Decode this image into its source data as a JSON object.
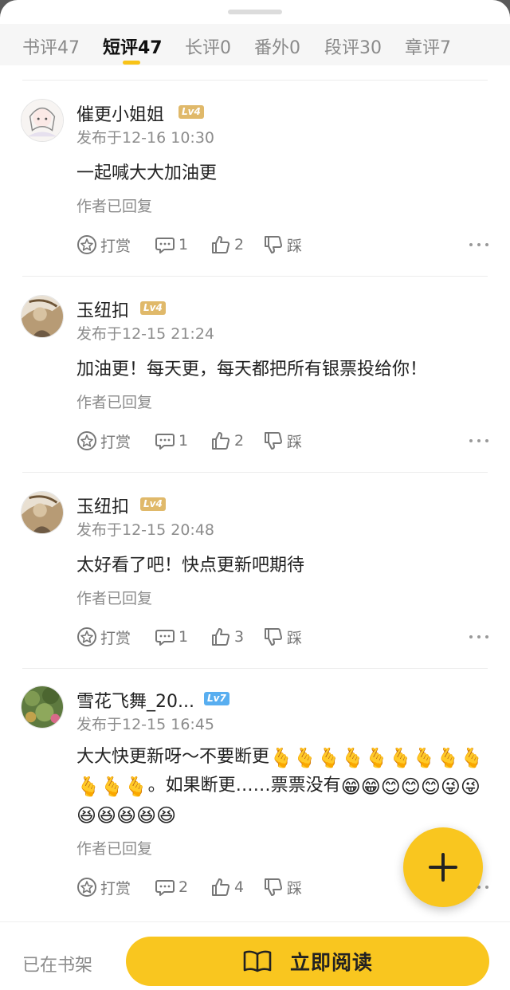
{
  "tabs": [
    {
      "label": "书评47"
    },
    {
      "label": "短评47"
    },
    {
      "label": "长评0"
    },
    {
      "label": "番外0"
    },
    {
      "label": "段评30"
    },
    {
      "label": "章评7"
    }
  ],
  "active_tab": "短评47",
  "comments": [
    {
      "username": "催更小姐姐",
      "level": "Lv4",
      "date": "发布于12-16 10:30",
      "content": "一起喊大大加油更",
      "replied": "作者已回复",
      "reward_label": "打赏",
      "reply_count": "1",
      "like_count": "2",
      "dislike_label": "踩"
    },
    {
      "username": "玉纽扣",
      "level": "Lv4",
      "date": "发布于12-15 21:24",
      "content": "加油更！每天更，每天都把所有银票投给你！",
      "replied": "作者已回复",
      "reward_label": "打赏",
      "reply_count": "1",
      "like_count": "2",
      "dislike_label": "踩"
    },
    {
      "username": "玉纽扣",
      "level": "Lv4",
      "date": "发布于12-15 20:48",
      "content": "太好看了吧！快点更新吧期待",
      "replied": "作者已回复",
      "reward_label": "打赏",
      "reply_count": "1",
      "like_count": "3",
      "dislike_label": "踩"
    },
    {
      "username": "雪花飞舞_20...",
      "level": "Lv7",
      "date": "发布于12-15 16:45",
      "content_start": "大大快更新呀～不要断更",
      "content_middle": "。如果断更……票票没有",
      "replied": "作者已回复",
      "reward_label": "打赏",
      "reply_count": "2",
      "like_count": "4",
      "dislike_label": "踩"
    }
  ],
  "emoji": {
    "finger_heart": "🫰",
    "grin": "😁",
    "smile": "😊",
    "wink": "😜",
    "laugh": "😆"
  },
  "bottom": {
    "shelf_label": "已在书架",
    "read_label": "立即阅读"
  },
  "colors": {
    "accent": "#f9c61f",
    "level_gold": "#e0b96a",
    "level_blue": "#58aef0"
  },
  "icons": [
    "reward-icon",
    "comment-icon",
    "thumbs-up-icon",
    "thumbs-down-icon",
    "more-icon",
    "plus-icon",
    "book-icon"
  ]
}
